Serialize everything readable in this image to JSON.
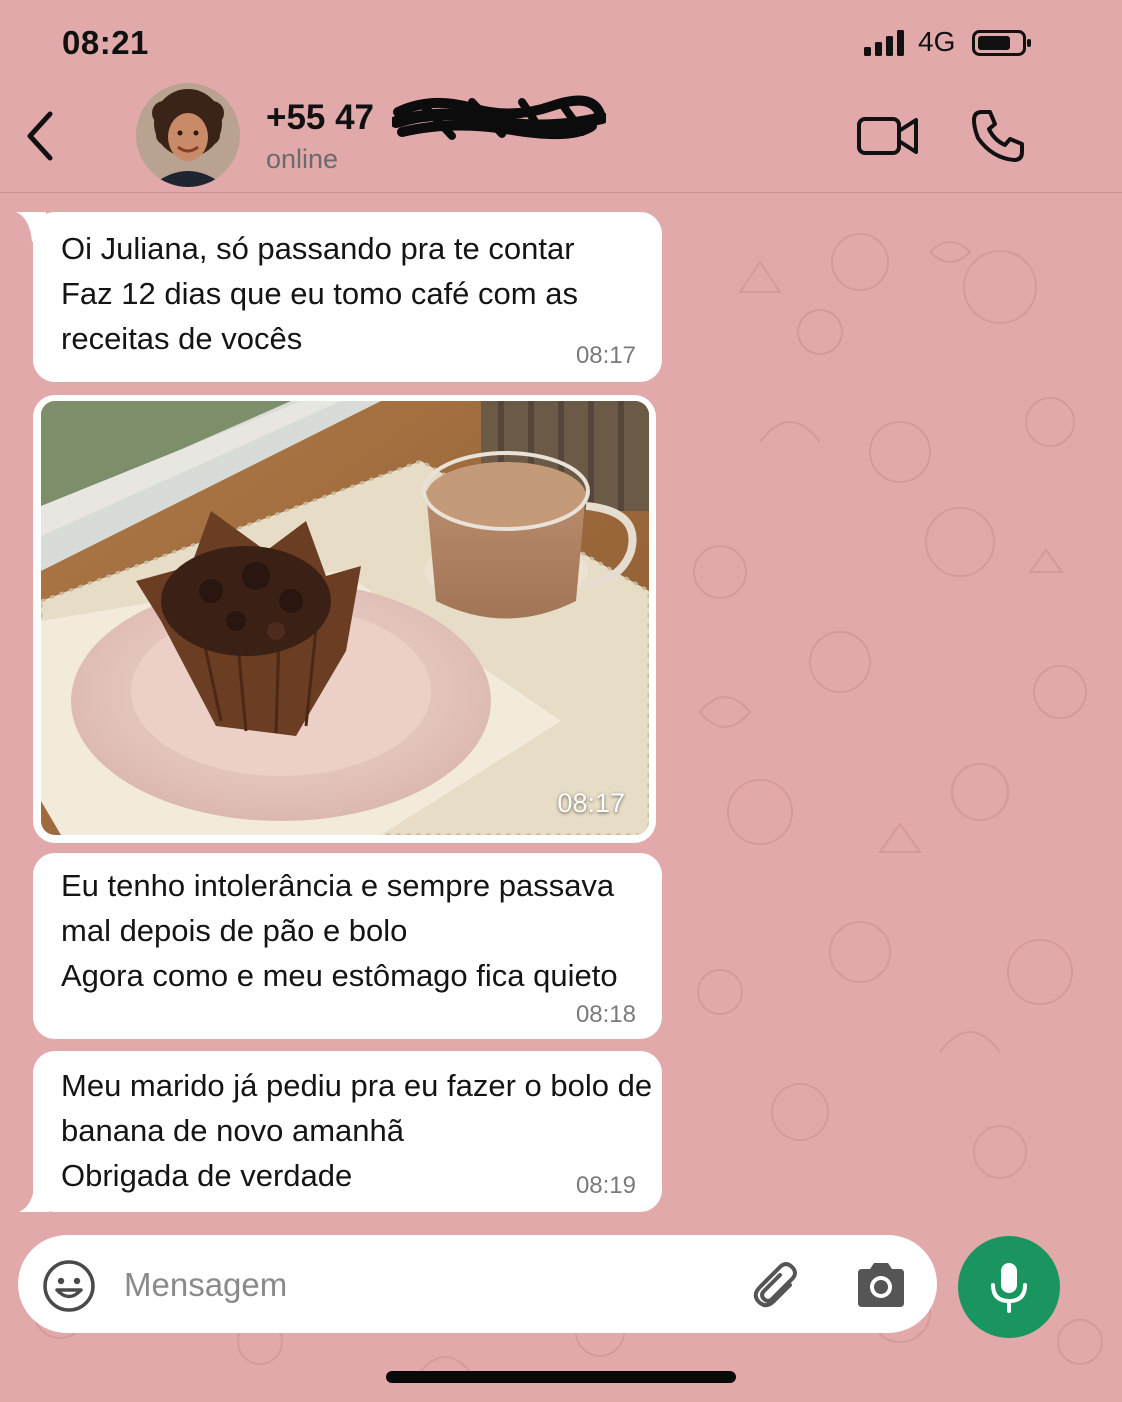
{
  "status_bar": {
    "time": "08:21",
    "network": "4G",
    "icons": [
      "signal-icon",
      "battery-icon"
    ]
  },
  "header": {
    "contact_name": "+55 47",
    "contact_status": "online",
    "icons": [
      "back-icon",
      "avatar",
      "video-call-icon",
      "phone-icon"
    ]
  },
  "messages": [
    {
      "lines": [
        "Oi Juliana, só passando pra te contar",
        "Faz 12 dias que eu tomo café com as",
        "receitas de vocês"
      ],
      "time": "08:17"
    },
    {
      "type": "photo",
      "time": "08:17"
    },
    {
      "lines": [
        "Eu tenho intolerância e sempre passava",
        "mal depois de pão e bolo",
        "Agora como e meu estômago fica quieto"
      ],
      "time": "08:18"
    },
    {
      "lines": [
        "Meu marido já pediu pra eu fazer o bolo de",
        "banana de novo amanhã",
        "Obrigada de verdade"
      ],
      "time": "08:19"
    }
  ],
  "composer": {
    "placeholder": "Mensagem",
    "value": "",
    "icons": [
      "emoji-icon",
      "paperclip-icon",
      "camera-icon",
      "microphone-icon"
    ]
  },
  "colors": {
    "background": "#e2a9ab",
    "bubble": "#ffffff",
    "send_button": "#1b9560",
    "timestamp": "#7a7a7a",
    "status_text": "#6b6b6b"
  }
}
